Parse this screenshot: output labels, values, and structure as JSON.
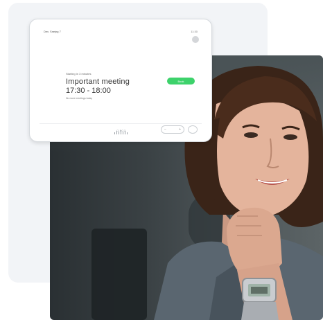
{
  "device": {
    "room_name": "Dev. Snejng 7",
    "status": "11:30",
    "meeting_label": "Starting in 3 minutes",
    "meeting_title": "Important meeting",
    "meeting_time": "17:30 - 18:00",
    "next_info": "No more meetings today",
    "book_button": "Book",
    "brand": "CISCO",
    "volume_minus": "−",
    "volume_plus": "+"
  },
  "colors": {
    "accent_green": "#3dd26b",
    "panel_bg": "#f2f4f7"
  }
}
